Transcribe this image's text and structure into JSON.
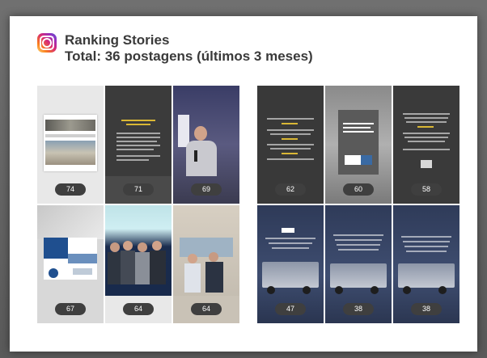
{
  "header": {
    "title": "Ranking Stories",
    "subtitle": "Total: 36 postagens (últimos 3 meses)",
    "icon": "instagram-icon"
  },
  "colors": {
    "frame": "#5d5d5d",
    "card": "#ffffff",
    "badge": "#3f3f3f",
    "text": "#3a3a3a"
  },
  "left_grid": [
    {
      "value": "74",
      "style": "light-photo"
    },
    {
      "value": "71",
      "style": "dark-text"
    },
    {
      "value": "69",
      "style": "speaker"
    },
    {
      "value": "67",
      "style": "blue-graphic"
    },
    {
      "value": "64",
      "style": "group-blue"
    },
    {
      "value": "64",
      "style": "group-beige"
    }
  ],
  "right_grid": [
    {
      "value": "62",
      "style": "dark-text"
    },
    {
      "value": "60",
      "style": "grey-poster"
    },
    {
      "value": "58",
      "style": "dark-text"
    },
    {
      "value": "47",
      "style": "truck-number"
    },
    {
      "value": "38",
      "style": "truck-text"
    },
    {
      "value": "38",
      "style": "truck-text"
    }
  ]
}
